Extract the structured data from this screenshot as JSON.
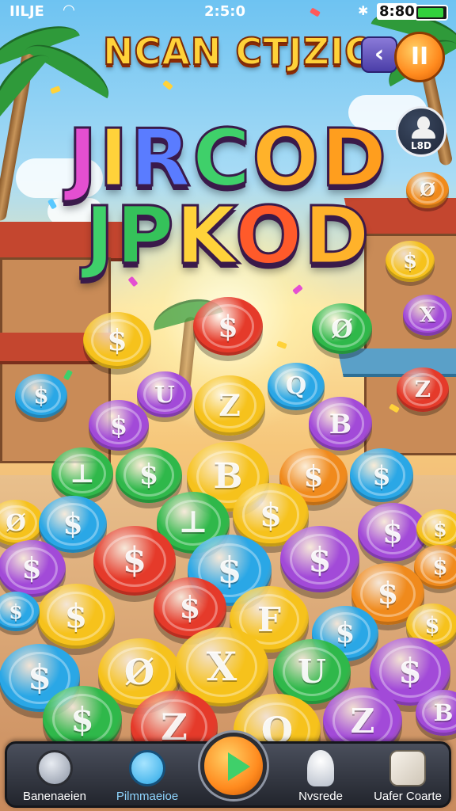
{
  "status_bar": {
    "carrier": "IILJE",
    "time": "2:5:0",
    "battery_text": "8:80",
    "battery_level": 0.92,
    "wifi_icon": "wifi-icon",
    "bluetooth_icon": "bluetooth-icon"
  },
  "header": {
    "title": "NCAN CTJZIO",
    "back_glyph": "‹",
    "pause_glyph": "II",
    "profile_label": "L8D"
  },
  "logo": {
    "line1": [
      "J",
      "I",
      "R",
      "C",
      "O",
      "D"
    ],
    "line2": [
      "J",
      "P",
      "K",
      "O",
      "D"
    ],
    "line1_colors": [
      "#e44fd1",
      "#ffd23a",
      "#5a7cff",
      "#3fd06a",
      "#ffb22a",
      "#ff9e1e"
    ],
    "line2_colors": [
      "#3fd06a",
      "#35c25a",
      "#ffd23a",
      "#ff5a2a",
      "#ffb22a"
    ]
  },
  "coins": {
    "glyphs": [
      "$",
      "$",
      "Ø",
      "X",
      "U",
      "$",
      "$",
      "Z",
      "Q",
      "Z",
      "B",
      "$",
      "⊥",
      "$",
      "B",
      "$",
      "Ø",
      "$",
      "⊥",
      "Ø",
      "$",
      "$",
      "$",
      "$",
      "$",
      "$",
      "$",
      "$",
      "$",
      "$",
      "$",
      "F",
      "$",
      "$",
      "$"
    ],
    "colors": {
      "gold": "#f6c21c",
      "red": "#e53a2a",
      "green": "#2fb84a",
      "blue": "#2aa7e6",
      "purple": "#a24ad8",
      "orange": "#f08a1c"
    }
  },
  "bottom_nav": {
    "items": [
      {
        "label": "Banenaeien",
        "icon": "magnifier-icon"
      },
      {
        "label": "Pilmmaeioe",
        "icon": "bubble-icon"
      },
      {
        "label": "Nvsrede",
        "icon": "person-icon"
      },
      {
        "label": "Uafer Coarte",
        "icon": "cube-face-icon"
      }
    ],
    "play_icon": "play-icon"
  }
}
